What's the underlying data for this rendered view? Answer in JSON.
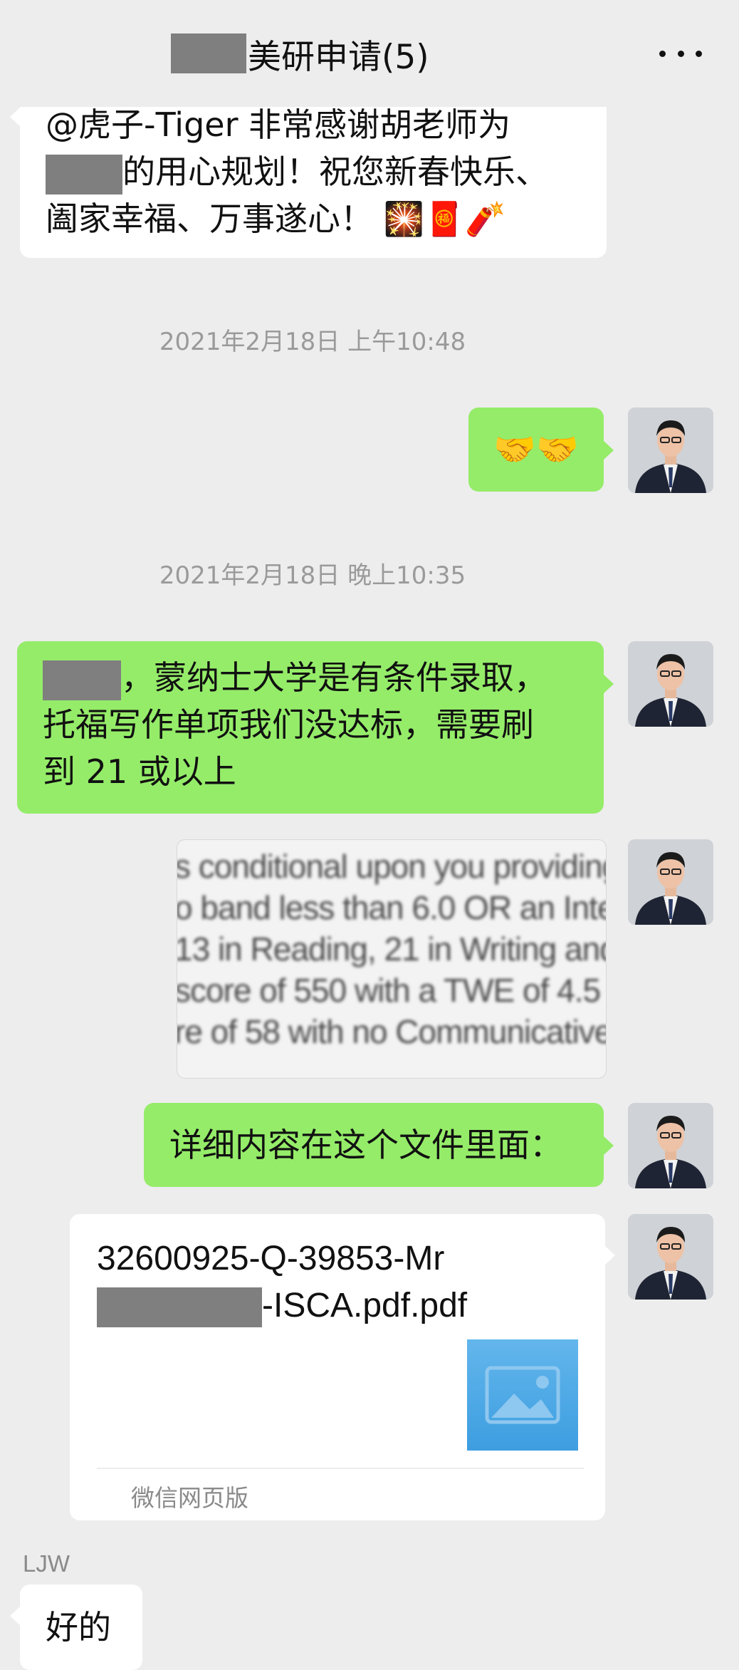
{
  "header": {
    "title": "美研申请(5)",
    "more_icon": "more-horizontal-icon"
  },
  "messages": {
    "m1": {
      "line1": "@虎子-Tiger   非常感谢胡老师为",
      "line2": "的用心规划！祝您新春快乐、",
      "line3": "阖家幸福、万事遂心！",
      "emojis": "🎇🧧🧨"
    },
    "ts1": "2021年2月18日 上午10:48",
    "m2": {
      "emojis": "🤝🤝"
    },
    "ts2": "2021年2月18日 晚上10:35",
    "m3": {
      "line1": "，蒙纳士大学是有条件录取，",
      "line2": "托福写作单项我们没达标，需要刷",
      "line3": "到 21 或以上"
    },
    "m4": {
      "image_lines": [
        "s conditional upon you providing",
        "o band less than 6.0  OR an Inter",
        "13 in Reading, 21 in Writing and",
        "  score of 550 with a TWE of 4.5",
        "re of 58 with no Communicative"
      ]
    },
    "m5": {
      "text": "详细内容在这个文件里面："
    },
    "m6": {
      "file_line1": "32600925-Q-39853-Mr",
      "file_line2": "-ISCA.pdf.pdf",
      "thumb_icon": "image-file-icon",
      "source": "微信网页版"
    },
    "m7": {
      "sender": "LJW",
      "text": "好的"
    }
  },
  "colors": {
    "background": "#ededed",
    "self_bubble": "#95ec69",
    "other_bubble": "#ffffff",
    "redaction": "#7f7f7f"
  }
}
